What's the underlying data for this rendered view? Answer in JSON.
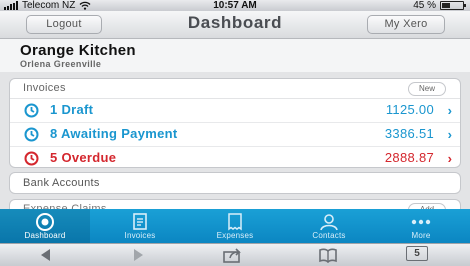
{
  "statusbar": {
    "carrier": "Telecom NZ",
    "time": "10:57 AM",
    "battery": "45 %",
    "battery_level": 0.45
  },
  "navbar": {
    "left_button": "Logout",
    "title": "Dashboard",
    "right_button": "My Xero"
  },
  "organization": {
    "name": "Orange Kitchen",
    "user": "Orlena Greenville"
  },
  "invoices": {
    "title": "Invoices",
    "new_label": "New",
    "rows": [
      {
        "label": "1 Draft",
        "amount": "1125.00",
        "color": "#1a96cf",
        "icon": "clock-icon"
      },
      {
        "label": "8 Awaiting Payment",
        "amount": "3386.51",
        "color": "#1a96cf",
        "icon": "clock-icon"
      },
      {
        "label": "5 Overdue",
        "amount": "2888.87",
        "color": "#d4272e",
        "icon": "clock-icon"
      }
    ]
  },
  "bank_accounts": {
    "title": "Bank Accounts"
  },
  "expense_claims": {
    "title": "Expense Claims",
    "add_label": "Add"
  },
  "tabs": [
    {
      "label": "Dashboard",
      "icon": "dashboard-icon",
      "active": true
    },
    {
      "label": "Invoices",
      "icon": "invoices-icon",
      "active": false
    },
    {
      "label": "Expenses",
      "icon": "expenses-icon",
      "active": false
    },
    {
      "label": "Contacts",
      "icon": "contacts-icon",
      "active": false
    },
    {
      "label": "More",
      "icon": "more-icon",
      "active": false
    }
  ],
  "browser_toolbar": {
    "tab_count": "5"
  },
  "colors": {
    "accent": "#1a96cf",
    "overdue": "#d4272e",
    "tabbar": "#0b86c2"
  }
}
